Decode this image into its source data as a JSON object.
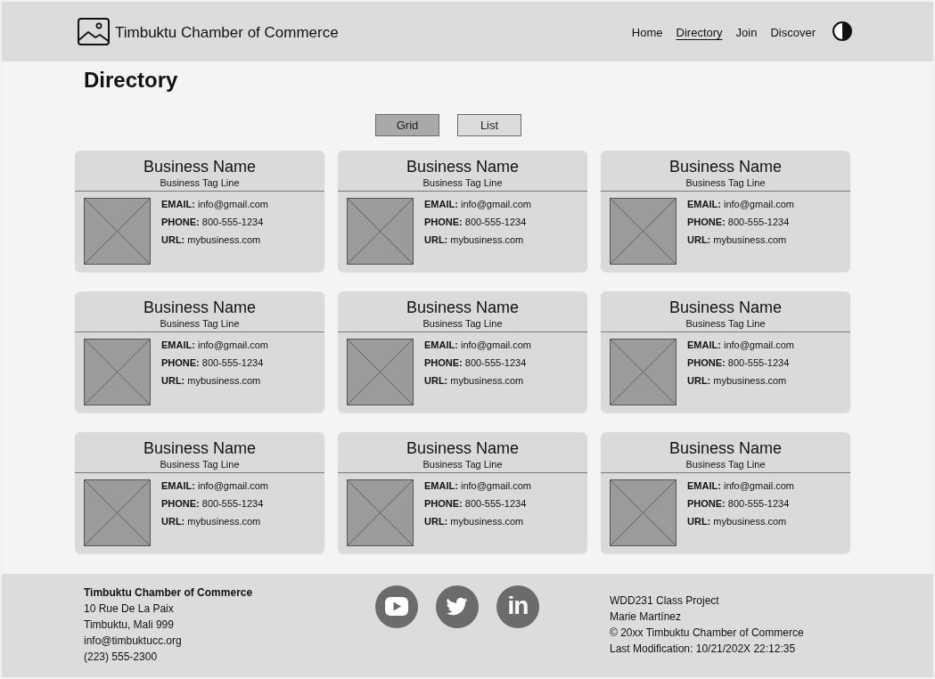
{
  "header": {
    "title": "Timbuktu Chamber of Commerce",
    "nav": [
      {
        "label": "Home",
        "selected": false
      },
      {
        "label": "Directory",
        "selected": true
      },
      {
        "label": "Join",
        "selected": false
      },
      {
        "label": "Discover",
        "selected": false
      }
    ]
  },
  "page_title": "Directory",
  "view_toggle": [
    {
      "label": "Grid",
      "selected": true
    },
    {
      "label": "List",
      "selected": false
    }
  ],
  "businesses": [
    {
      "name": "Business Name",
      "tagline": "Business Tag Line",
      "details": [
        "**EMAIL:** info@gmail.com",
        "**PHONE:** 800-555-1234",
        "**URL:** mybusiness.com"
      ]
    },
    {
      "name": "Business Name",
      "tagline": "Business Tag Line",
      "details": [
        "**EMAIL:** info@gmail.com",
        "**PHONE:** 800-555-1234",
        "**URL:** mybusiness.com"
      ]
    },
    {
      "name": "Business Name",
      "tagline": "Business Tag Line",
      "details": [
        "**EMAIL:** info@gmail.com",
        "**PHONE:** 800-555-1234",
        "**URL:** mybusiness.com"
      ]
    },
    {
      "name": "Business Name",
      "tagline": "Business Tag Line",
      "details": [
        "**EMAIL:** info@gmail.com",
        "**PHONE:** 800-555-1234",
        "**URL:** mybusiness.com"
      ]
    },
    {
      "name": "Business Name",
      "tagline": "Business Tag Line",
      "details": [
        "**EMAIL:** info@gmail.com",
        "**PHONE:** 800-555-1234",
        "**URL:** mybusiness.com"
      ]
    },
    {
      "name": "Business Name",
      "tagline": "Business Tag Line",
      "details": [
        "**EMAIL:** info@gmail.com",
        "**PHONE:** 800-555-1234",
        "**URL:** mybusiness.com"
      ]
    },
    {
      "name": "Business Name",
      "tagline": "Business Tag Line",
      "details": [
        "**EMAIL:** info@gmail.com",
        "**PHONE:** 800-555-1234",
        "**URL:** mybusiness.com"
      ]
    },
    {
      "name": "Business Name",
      "tagline": "Business Tag Line",
      "details": [
        "**EMAIL:** info@gmail.com",
        "**PHONE:** 800-555-1234",
        "**URL:** mybusiness.com"
      ]
    },
    {
      "name": "Business Name",
      "tagline": "Business Tag Line",
      "details": [
        "**EMAIL:** info@gmail.com",
        "**PHONE:** 800-555-1234",
        "**URL:** mybusiness.com"
      ]
    }
  ],
  "footer": {
    "organization": {
      "name": "Timbuktu Chamber of Commerce",
      "lines": [
        "10 Rue De La Paix",
        "Timbuktu, Mali 999",
        "info@timbuktucc.org",
        "(223) 555-2300"
      ]
    },
    "social": [
      {
        "kind": "play"
      },
      {
        "kind": "bird"
      },
      {
        "kind": "text",
        "text": "in"
      }
    ],
    "credits": [
      "WDD231 Class Project",
      "Marie Martínez",
      "© 20xx Timbuktu Chamber of Commerce",
      "Last Modification: 10/21/202X 22:12:35"
    ]
  }
}
